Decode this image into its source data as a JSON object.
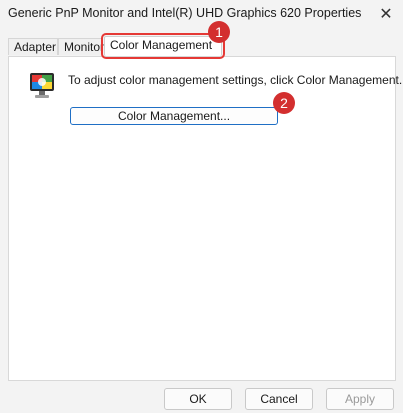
{
  "window": {
    "title": "Generic PnP Monitor and Intel(R) UHD Graphics 620 Properties",
    "close_glyph": "✕"
  },
  "tabs": [
    {
      "label": "Adapter",
      "active": false
    },
    {
      "label": "Monitor",
      "active": false
    },
    {
      "label": "Color Management",
      "active": true
    }
  ],
  "panel": {
    "icon": "color-monitor-icon",
    "instruction": "To adjust color management settings, click Color Management.",
    "button_label": "Color Management..."
  },
  "annotations": [
    {
      "label": "1"
    },
    {
      "label": "2"
    }
  ],
  "footer": {
    "ok_label": "OK",
    "cancel_label": "Cancel",
    "apply_label": "Apply"
  },
  "colors": {
    "accent_blue": "#1f6fc5",
    "annotation_red": "#d32f2f"
  }
}
